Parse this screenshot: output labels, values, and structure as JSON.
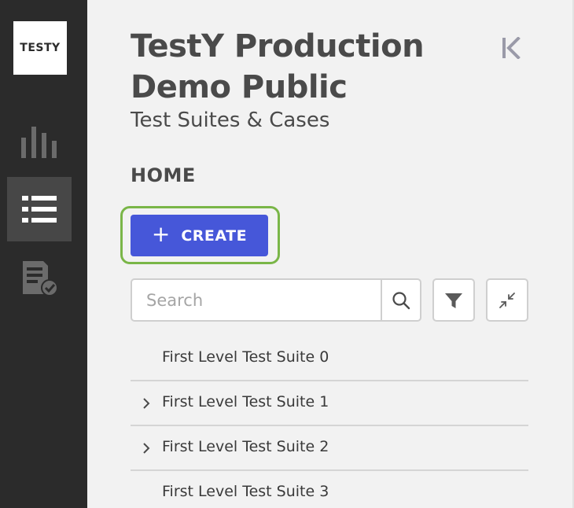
{
  "rail": {
    "logo_text": "TESTY",
    "items": [
      {
        "icon": "bar-chart-icon",
        "active": false
      },
      {
        "icon": "list-icon",
        "active": true
      },
      {
        "icon": "test-run-check-icon",
        "active": false
      }
    ]
  },
  "header": {
    "title": "TestY Production Demo Public",
    "subtitle": "Test Suites & Cases",
    "collapse_icon": "collapse-left-icon"
  },
  "breadcrumb": {
    "current": "HOME"
  },
  "toolbar": {
    "create_label": "CREATE",
    "create_icon": "plus-icon",
    "search_placeholder": "Search",
    "filter_icon": "filter-icon",
    "collapse_all_icon": "collapse-arrows-icon"
  },
  "tree": {
    "items": [
      {
        "label": "First Level Test Suite 0",
        "expandable": false
      },
      {
        "label": "First Level Test Suite 1",
        "expandable": true
      },
      {
        "label": "First Level Test Suite 2",
        "expandable": true
      },
      {
        "label": "First Level Test Suite 3",
        "expandable": false
      }
    ]
  },
  "colors": {
    "rail_bg": "#2b2b2b",
    "rail_active": "#474747",
    "primary": "#4657d9",
    "focus_ring": "#7ab648",
    "text": "#4a4a4a"
  }
}
